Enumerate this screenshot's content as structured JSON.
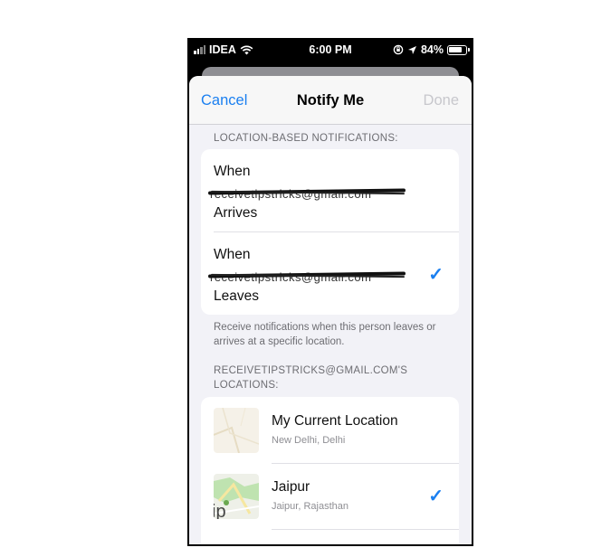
{
  "status_bar": {
    "carrier": "IDEA",
    "time": "6:00 PM",
    "battery": "84%",
    "battery_level": 0.84,
    "icons": [
      "signal-icon",
      "wifi-icon",
      "rotation-lock-icon",
      "location-arrow-icon",
      "battery-icon"
    ]
  },
  "nav": {
    "cancel_label": "Cancel",
    "title": "Notify Me",
    "done_label": "Done"
  },
  "notifications": {
    "header": "LOCATION-BASED NOTIFICATIONS:",
    "options": [
      {
        "line1": "When",
        "redacted_email": "receivetipstricks@gmail.com",
        "line3": "Arrives",
        "selected": false
      },
      {
        "line1": "When",
        "redacted_email": "receivetipstricks@gmail.com",
        "line3": "Leaves",
        "selected": true
      }
    ],
    "footer": "Receive notifications when this person leaves or arrives at a specific location."
  },
  "locations": {
    "header": "RECEIVETIPSTRICKS@GMAIL.COM'S LOCATIONS:",
    "items": [
      {
        "name": "My Current Location",
        "subtitle": "New Delhi, Delhi",
        "selected": false
      },
      {
        "name": "Jaipur",
        "subtitle": "Jaipur, Rajasthan",
        "selected": true,
        "map_label": "ip"
      }
    ]
  },
  "colors": {
    "accent": "#1a7ff0",
    "background": "#f2f2f7",
    "secondary_text": "#6d6d72"
  }
}
